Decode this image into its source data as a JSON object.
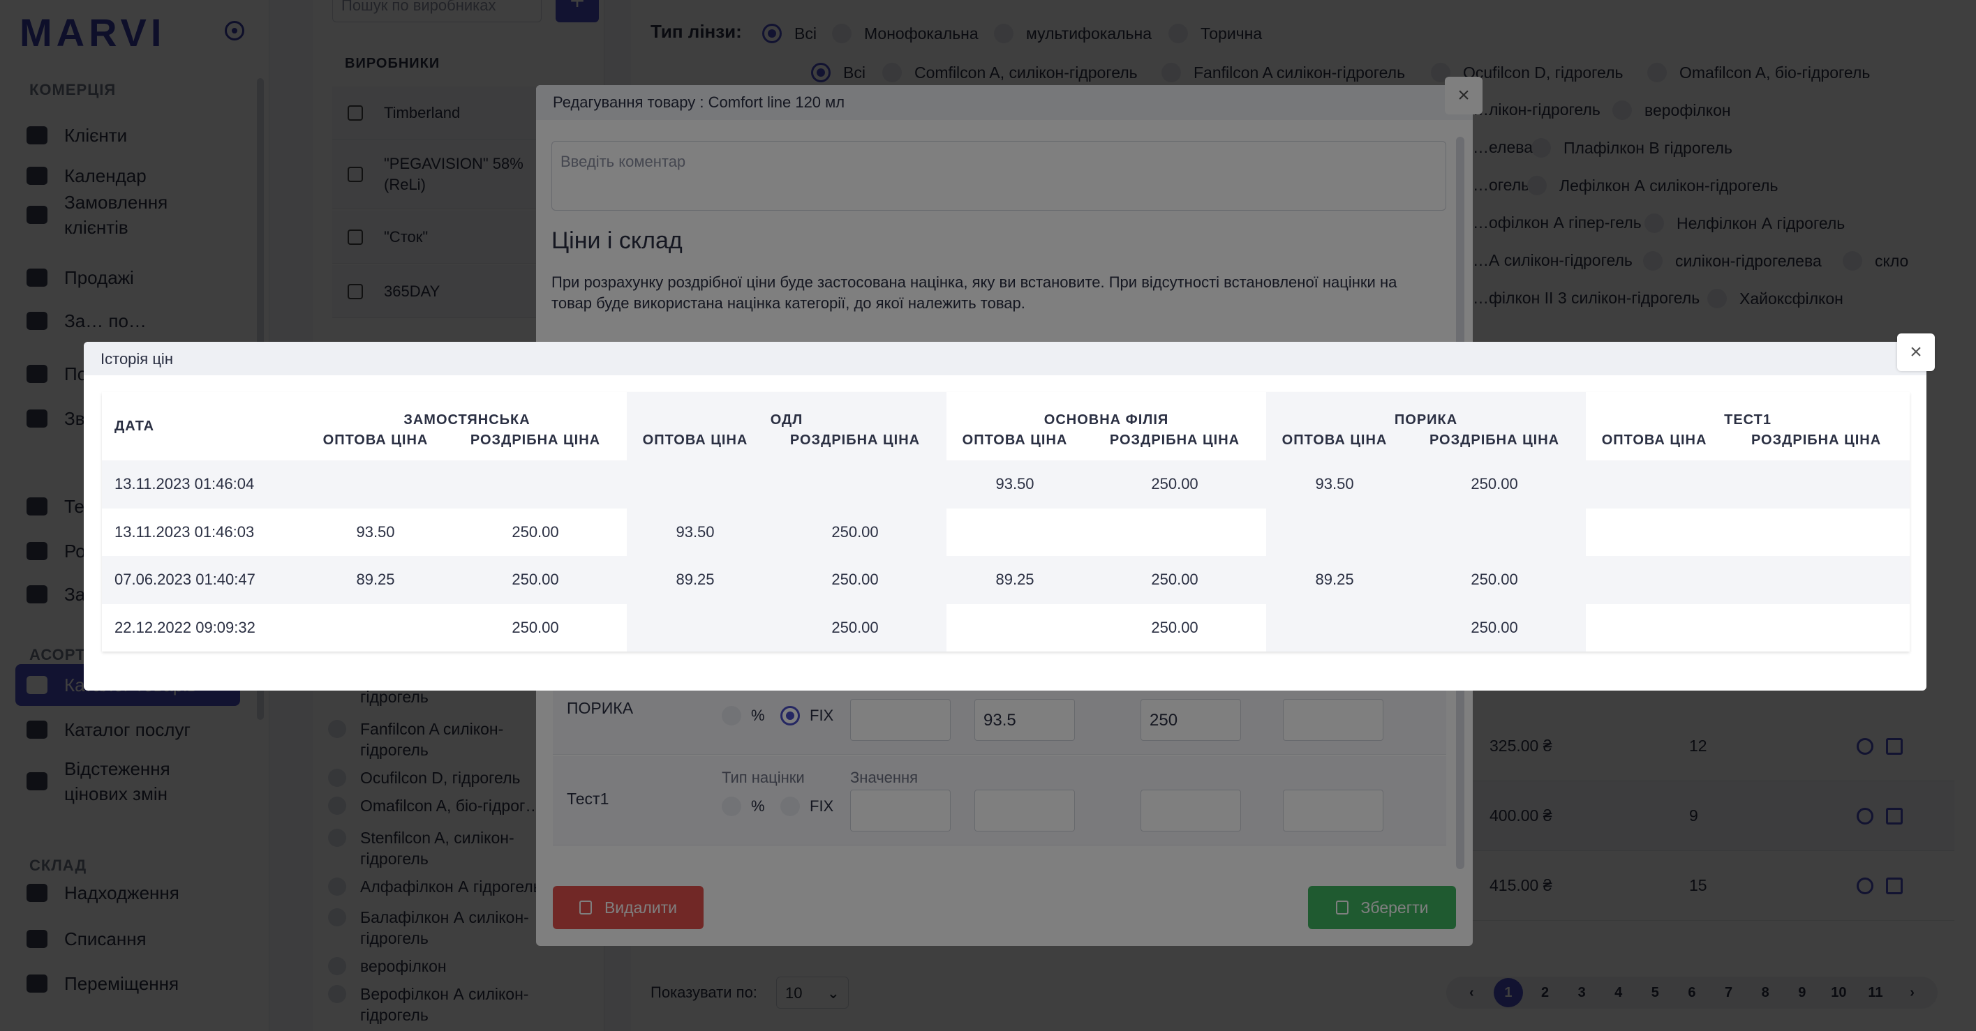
{
  "app": {
    "logo": "MARVI"
  },
  "sidebar": {
    "sections": [
      {
        "title": "КОМЕРЦІЯ",
        "items": [
          "Клієнти",
          "Календар",
          "Замовлення клієнтів",
          "Продажі",
          "За… по…",
          "По…",
          "Зв…"
        ]
      },
      {
        "title": "",
        "items": [
          "Те…",
          "Ро…",
          "За…"
        ]
      },
      {
        "title": "АСОРТ…",
        "items": [
          "Каталог товарів",
          "Каталог послуг",
          "Відстеження цінових змін"
        ]
      },
      {
        "title": "СКЛАД",
        "items": [
          "Надходження",
          "Списання",
          "Переміщення"
        ]
      }
    ],
    "active": "Каталог товарів"
  },
  "filters": {
    "search_placeholder": "Пошук по виробниках",
    "manufacturers_title": "ВИРОБНИКИ",
    "manufacturers": [
      "Timberland",
      "\"PEGAVISION\" 58% (ReLi)",
      "\"Сток\"",
      "365DAY"
    ],
    "materials": [
      "гідрогель",
      "Fanfilcon A силікон-гідрогель",
      "Ocufilcon D, гідрогель",
      "Omafilcon A, біо-гідрог…",
      "Stenfilcon A, силікон-гідрогель",
      "Алфафілкон А гідрогель",
      "Балафілкон А силікон-гідрогель",
      "верофілкон",
      "Верофілкон А силікон-гідрогель"
    ]
  },
  "main": {
    "lens_type_label": "Тип лінзи:",
    "lens_types": [
      "Всі",
      "Монофокальна",
      "мультифокальна",
      "Торична"
    ],
    "materials_row": [
      "Всі",
      "Comfilcon A, силікон-гідрогель",
      "Fanfilcon A силікон-гідрогель",
      "Ocufilcon D, гідрогель",
      "Omafilcon A, біо-гідрогель"
    ],
    "materials_row2": [
      "…лікон-гідрогель",
      "верофілкон"
    ],
    "materials_row3": [
      "…елева",
      "Плафілкон В гідрогель"
    ],
    "materials_row4": [
      "…огель",
      "Лефілкон А силікон-гідрогель"
    ],
    "materials_row5": [
      "…офілкон А гіпер-гель",
      "Нелфілкон А гідрогель"
    ],
    "materials_row6": [
      "…А силікон-гідрогель",
      "силікон-гідрогелева",
      "скло"
    ],
    "materials_row7": [
      "…філкон II 3 силікон-гідрогель",
      "Хайоксфілкон"
    ],
    "rows": [
      {
        "price": "325.00 ₴",
        "qty": "12"
      },
      {
        "price": "400.00 ₴",
        "qty": "9"
      },
      {
        "price": "415.00 ₴",
        "qty": "15"
      }
    ],
    "pager_label": "Показувати по:",
    "page_size": "10",
    "pages": [
      "‹",
      "1",
      "2",
      "3",
      "4",
      "5",
      "6",
      "7",
      "8",
      "9",
      "10",
      "11",
      "›"
    ],
    "current_page": "1"
  },
  "edit_modal": {
    "title": "Редагування товару : Comfort line 120 мл",
    "comment_placeholder": "Введіть коментар",
    "prices_title": "Ціни і склад",
    "prices_note": "При розрахунку роздрібної ціни буде застосована націнка, яку ви встановите. При відсутності встановленої націнки на товар буде використана націнка категорії, до якої належить товар.",
    "markup_type_label": "Тип націнки",
    "value_label": "Значення",
    "percent": "%",
    "fix": "FIX",
    "branches": [
      {
        "name": "ПОРИКА",
        "mode": "FIX",
        "value": "",
        "wholesale": "93.5",
        "retail": "250",
        "extra": ""
      },
      {
        "name": "Тест1",
        "mode": "",
        "value": "",
        "wholesale": "",
        "retail": "",
        "extra": ""
      }
    ],
    "delete_label": "Видалити",
    "save_label": "Зберегти",
    "close": "×"
  },
  "history_modal": {
    "title": "Історія цін",
    "close": "×",
    "date_header": "ДАТА",
    "branches": [
      "ЗАМОСТЯНСЬКА",
      "ОДЛ",
      "ОСНОВНА ФІЛІЯ",
      "ПОРИКА",
      "ТЕСТ1"
    ],
    "sub_wholesale": "ОПТОВА ЦІНА",
    "sub_retail": "РОЗДРІБНА ЦІНА",
    "rows": [
      {
        "date": "13.11.2023 01:46:04",
        "v": [
          "",
          "",
          "",
          "",
          "93.50",
          "250.00",
          "93.50",
          "250.00",
          "",
          ""
        ]
      },
      {
        "date": "13.11.2023 01:46:03",
        "v": [
          "93.50",
          "250.00",
          "93.50",
          "250.00",
          "",
          "",
          "",
          "",
          "",
          ""
        ]
      },
      {
        "date": "07.06.2023 01:40:47",
        "v": [
          "89.25",
          "250.00",
          "89.25",
          "250.00",
          "89.25",
          "250.00",
          "89.25",
          "250.00",
          "",
          ""
        ]
      },
      {
        "date": "22.12.2022 09:09:32",
        "v": [
          "",
          "250.00",
          "",
          "250.00",
          "",
          "250.00",
          "",
          "250.00",
          "",
          ""
        ]
      }
    ]
  }
}
